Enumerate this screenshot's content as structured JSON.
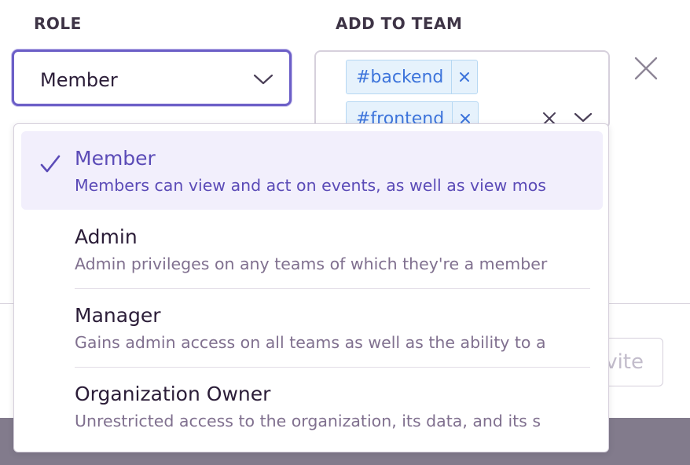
{
  "labels": {
    "role": "ROLE",
    "add_to_team": "ADD TO TEAM"
  },
  "role_select": {
    "value": "Member",
    "chevron_icon": "chevron-down-icon"
  },
  "team_select": {
    "tags": [
      {
        "label": "#backend",
        "remove_icon": "close-icon"
      },
      {
        "label": "#frontend",
        "remove_icon": "close-icon"
      }
    ],
    "clear_icon": "close-icon",
    "chevron_icon": "chevron-down-icon"
  },
  "row_remove_icon": "close-icon",
  "invite_button": {
    "label": "Send Invite",
    "visible_label": "vite"
  },
  "role_options": [
    {
      "title": "Member",
      "description": "Members can view and act on events, as well as view mos",
      "selected": true
    },
    {
      "title": "Admin",
      "description": "Admin privileges on any teams of which they're a member",
      "selected": false
    },
    {
      "title": "Manager",
      "description": "Gains admin access on all teams as well as the ability to a",
      "selected": false
    },
    {
      "title": "Organization Owner",
      "description": "Unrestricted access to the organization, its data, and its s",
      "selected": false
    }
  ],
  "colors": {
    "accent": "#6c5fc7",
    "selected_text": "#5b4bb7",
    "selected_bg": "#f2effc",
    "tag_text": "#3d74db",
    "tag_bg": "#e6f2fc"
  }
}
